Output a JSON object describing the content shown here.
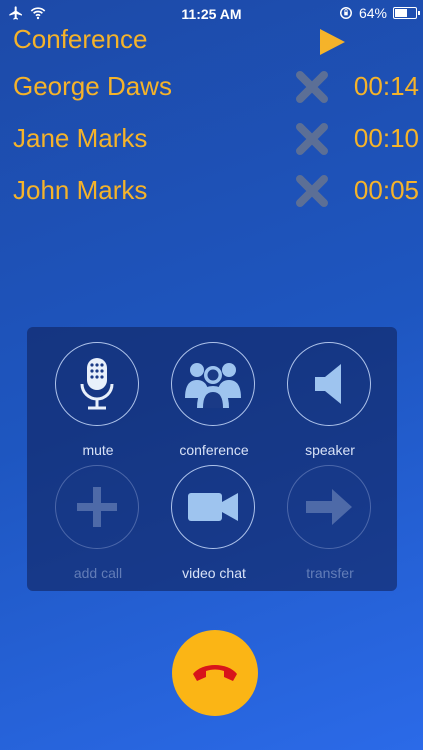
{
  "status_bar": {
    "time": "11:25 AM",
    "battery": "64%",
    "battery_level": 0.64,
    "icons": [
      "airplane-icon",
      "wifi-icon",
      "rotation-lock-icon",
      "battery-icon"
    ]
  },
  "header": {
    "title": "Conference",
    "play_icon": "play-icon"
  },
  "participants": [
    {
      "name": "George Daws",
      "duration": "00:14"
    },
    {
      "name": "Jane Marks",
      "duration": "00:10"
    },
    {
      "name": "John Marks",
      "duration": "00:05"
    }
  ],
  "controls": {
    "mute": "mute",
    "conference": "conference",
    "speaker": "speaker",
    "add_call": "add call",
    "video_chat": "video chat",
    "transfer": "transfer"
  },
  "colors": {
    "accent": "#f5b32a",
    "end_call": "#fbb515",
    "remove_icon": "#5c6f96",
    "icon_light": "#9ec4ef"
  }
}
